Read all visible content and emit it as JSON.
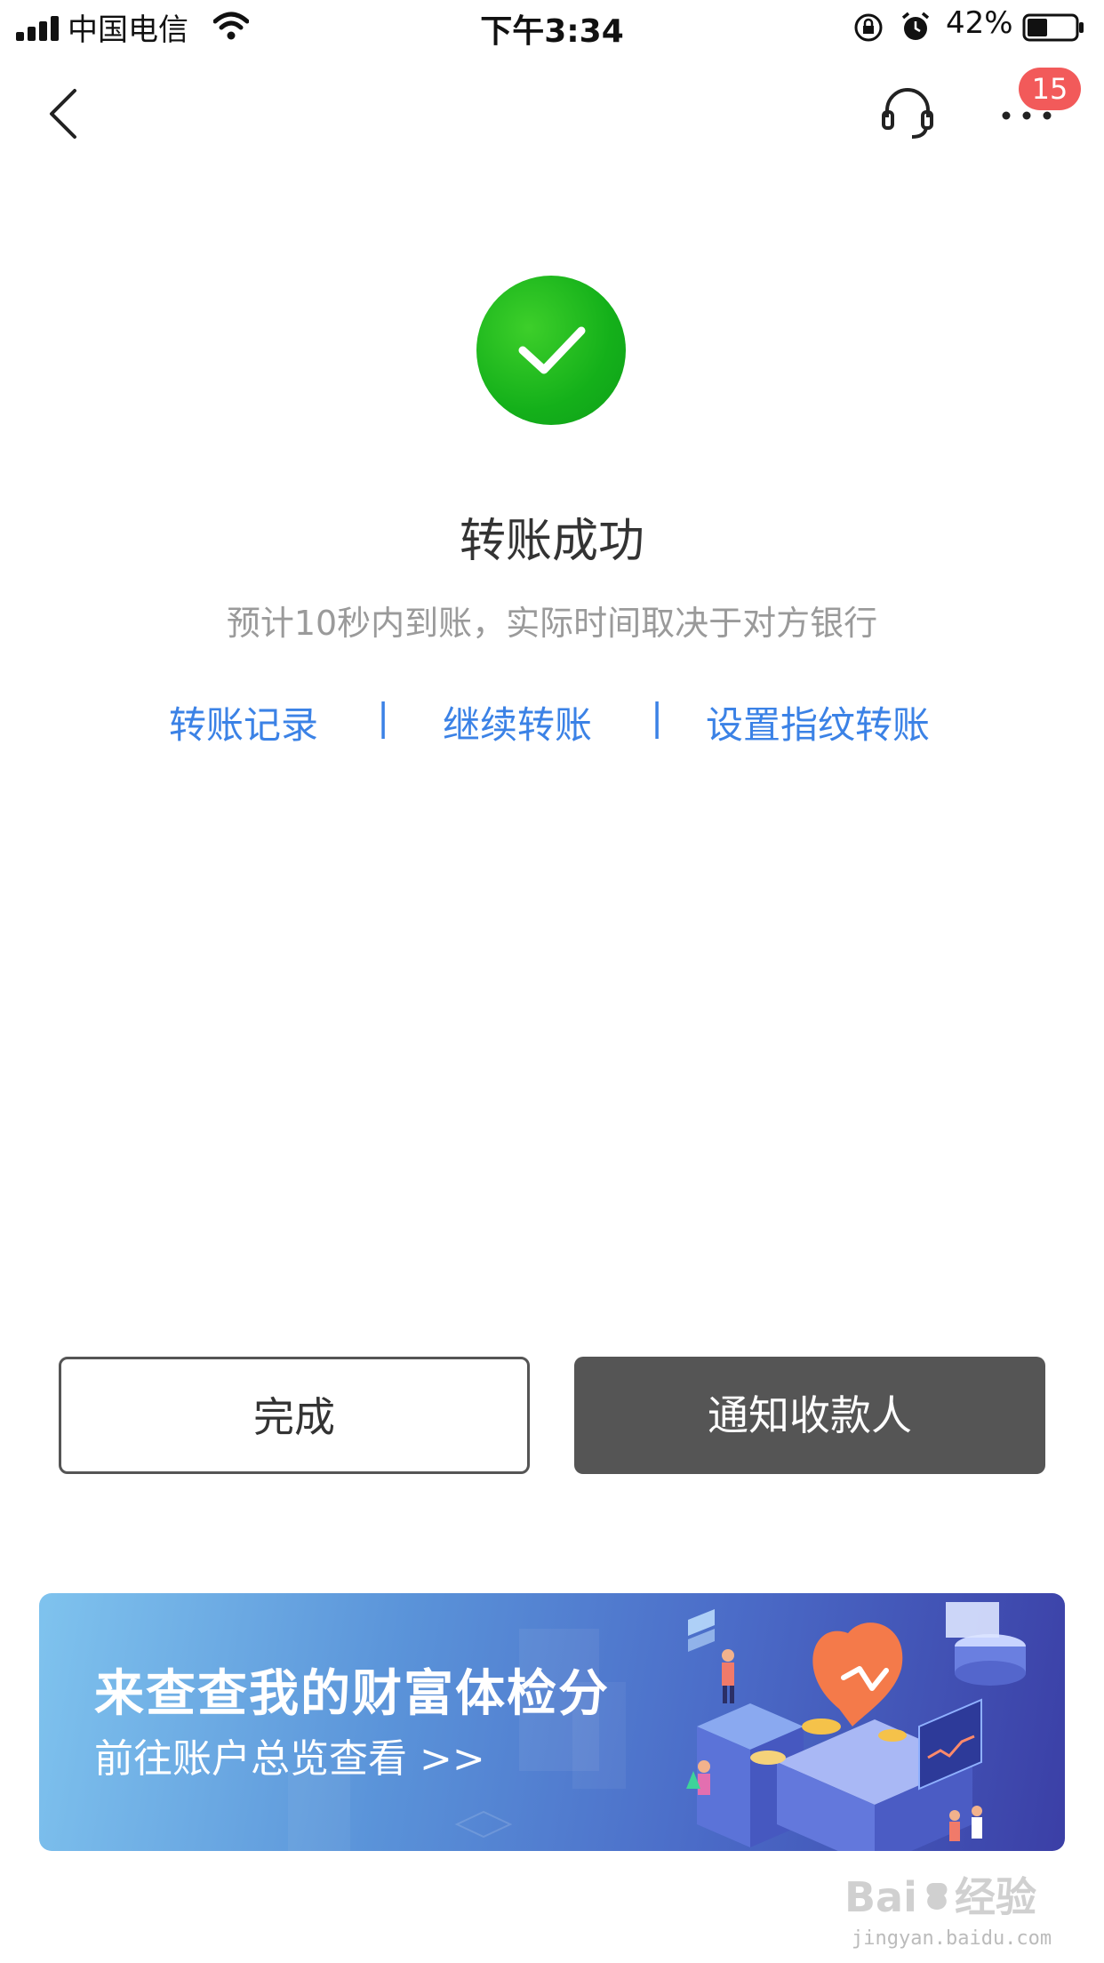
{
  "status_bar": {
    "carrier": "中国电信",
    "time": "下午3:34",
    "battery_percent": "42%",
    "battery_level": 0.42,
    "icons": [
      "signal-icon",
      "wifi-icon",
      "orientation-lock-icon",
      "alarm-icon",
      "battery-icon"
    ]
  },
  "nav": {
    "back_icon": "chevron-left-icon",
    "service_icon": "headset-icon",
    "more_icon": "more-icon",
    "badge_count": "15",
    "badge_color": "#f25a5a"
  },
  "result": {
    "icon": "check-circle-icon",
    "icon_color": "#1db320",
    "title": "转账成功",
    "subtitle": "预计10秒内到账，实际时间取决于对方银行"
  },
  "links": {
    "color": "#3b82e6",
    "items": [
      "转账记录",
      "继续转账",
      "设置指纹转账"
    ],
    "separator": "|"
  },
  "buttons": {
    "done_label": "完成",
    "notify_label": "通知收款人",
    "notify_bg": "#555555"
  },
  "banner": {
    "title": "来查查我的财富体检分",
    "subtitle": "前往账户总览查看 >>"
  },
  "watermark": {
    "text": "jingyan.baidu.com"
  }
}
